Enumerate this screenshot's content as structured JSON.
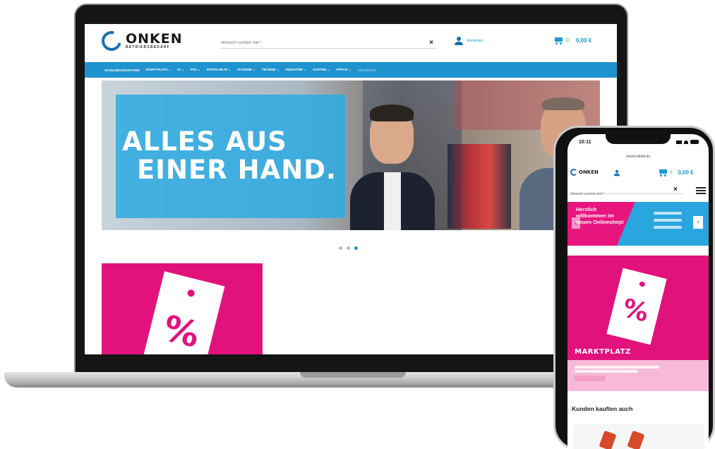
{
  "desktop": {
    "logo": {
      "name": "ONKEN",
      "subtitle": "BETRIEBSBEDARF"
    },
    "search": {
      "placeholder": "Wonach suchen Sie?",
      "clear": "×"
    },
    "account": {
      "label": "Anmelden"
    },
    "cart": {
      "count": "0",
      "total": "0,00 €"
    },
    "nav": [
      {
        "label": "SCHULBELEUCHTUNG"
      },
      {
        "label": "MARKTPLATZ ⌄"
      },
      {
        "label": "KI ⌄"
      },
      {
        "label": "PSA ⌄"
      },
      {
        "label": "ERSTE-HILFE ⌄"
      },
      {
        "label": "HYGIENE ⌄"
      },
      {
        "label": "TECHNIK ⌄"
      },
      {
        "label": "INDUSTRIE ⌄"
      },
      {
        "label": "GARTEN ⌄"
      },
      {
        "label": "OFFICE ⌄"
      },
      {
        "label": "ANGEBOTE"
      }
    ],
    "hero": {
      "line1": "ALLES AUS",
      "line2": "EINER HAND."
    },
    "slider": {
      "count": 3,
      "active_index": 2
    },
    "promo": {
      "symbol": "%"
    }
  },
  "mobile": {
    "status_time": "15:11",
    "url": "onken-direkt.de",
    "logo": {
      "name": "ONKEN"
    },
    "cart": {
      "count": "0",
      "total": "0,00 €"
    },
    "search": {
      "placeholder": "Wonach suchen Sie?",
      "clear": "×"
    },
    "banner": {
      "text": "Herzlich willkommen im neuen Onlineshop!",
      "prev": "‹",
      "next": "›"
    },
    "tile": {
      "symbol": "%",
      "title": "MARKTPLATZ"
    },
    "related_heading": "Kunden kauften auch"
  },
  "colors": {
    "brand_blue": "#1e93cf",
    "brand_pink": "#e2127c",
    "logo_blue": "#1a6fae"
  }
}
